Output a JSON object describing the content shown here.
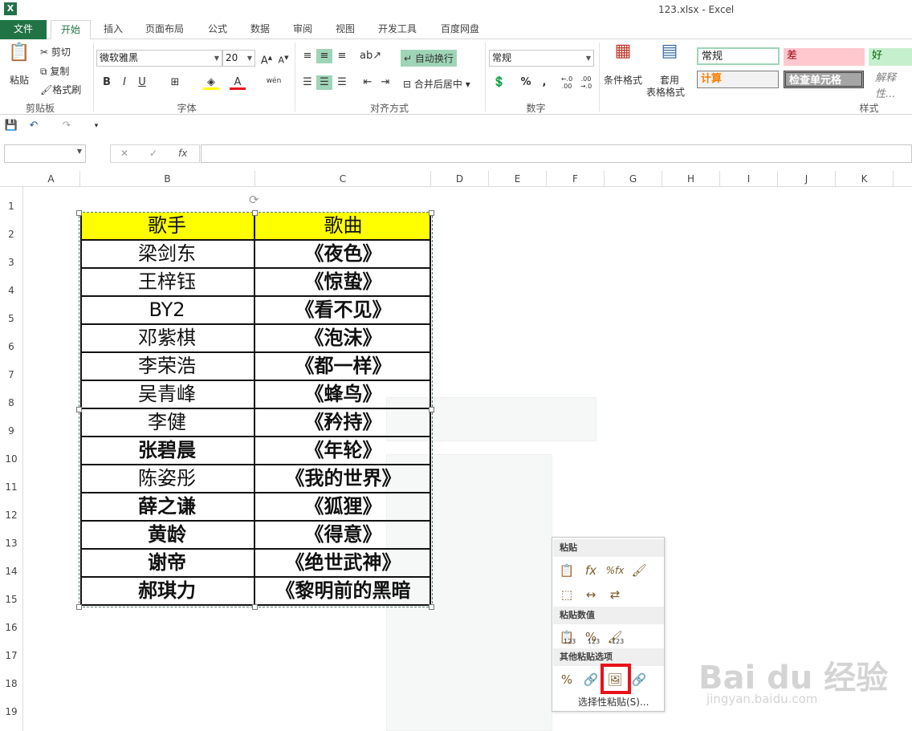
{
  "app": {
    "window_title": "123.xlsx - Excel",
    "icon_glyph": "X"
  },
  "tabs": [
    "文件",
    "开始",
    "插入",
    "页面布局",
    "公式",
    "数据",
    "审阅",
    "视图",
    "开发工具",
    "百度网盘"
  ],
  "ribbon": {
    "clipboard": {
      "paste": "粘贴",
      "cut": "剪切",
      "copy": "复制",
      "format_painter": "格式刷",
      "label": "剪贴板"
    },
    "font": {
      "name": "微软雅黑",
      "size": "20",
      "label": "字体",
      "bold": "B",
      "italic": "I",
      "underline": "U",
      "font_color_glyph": "A",
      "phonetic": "wén"
    },
    "alignment": {
      "wrap": "自动换行",
      "merge": "合并后居中",
      "label": "对齐方式"
    },
    "number": {
      "format": "常规",
      "label": "数字",
      "percent": "%",
      "comma": ",",
      "inc_dec": "←.0 .00",
      "dec_dec": ".00 →.0"
    },
    "styles_group": {
      "conditional": "条件格式",
      "table_format_1": "套用",
      "table_format_2": "表格格式",
      "label": "样式"
    },
    "cell_styles": {
      "normal": "常规",
      "bad": "差",
      "good": "好",
      "calc": "计算",
      "check": "检查单元格",
      "explain": "解释性..."
    }
  },
  "colors": {
    "accent": "#217346",
    "header_fill": "#ffff00",
    "highlight": "#e8121a",
    "bad_fill": "#ffc7ce",
    "good_fill": "#c6efce"
  },
  "formula_bar": {
    "fx": "fx",
    "cancel": "✕",
    "enter": "✓"
  },
  "columns": [
    "A",
    "B",
    "C",
    "D",
    "E",
    "F",
    "G",
    "H",
    "I",
    "J",
    "K"
  ],
  "rows": [
    "1",
    "2",
    "3",
    "4",
    "5",
    "6",
    "7",
    "8",
    "9",
    "10",
    "11",
    "12",
    "13",
    "14",
    "15",
    "16",
    "17",
    "18",
    "19"
  ],
  "table": {
    "header": [
      "歌手",
      "歌曲"
    ],
    "rows": [
      [
        "梁剑东",
        "《夜色》"
      ],
      [
        "王梓钰",
        "《惊蛰》"
      ],
      [
        "BY2",
        "《看不见》"
      ],
      [
        "邓紫棋",
        "《泡沫》"
      ],
      [
        "李荣浩",
        "《都一样》"
      ],
      [
        "吴青峰",
        "《蜂鸟》"
      ],
      [
        "李健",
        "《矜持》"
      ],
      [
        "张碧晨",
        "《年轮》"
      ],
      [
        "陈姿彤",
        "《我的世界》"
      ],
      [
        "薛之谦",
        "《狐狸》"
      ],
      [
        "黄龄",
        "《得意》"
      ],
      [
        "谢帝",
        "《绝世武神》"
      ],
      [
        "郝琪力",
        "《黎明前的黑暗"
      ]
    ]
  },
  "paste_menu": {
    "section_paste": "粘贴",
    "section_values": "粘贴数值",
    "section_other": "其他粘贴选项",
    "values_sub": "123",
    "footer": "选择性粘贴(S)..."
  },
  "watermark": {
    "logo": "Bai du 经验",
    "url": "jingyan.baidu.com"
  }
}
